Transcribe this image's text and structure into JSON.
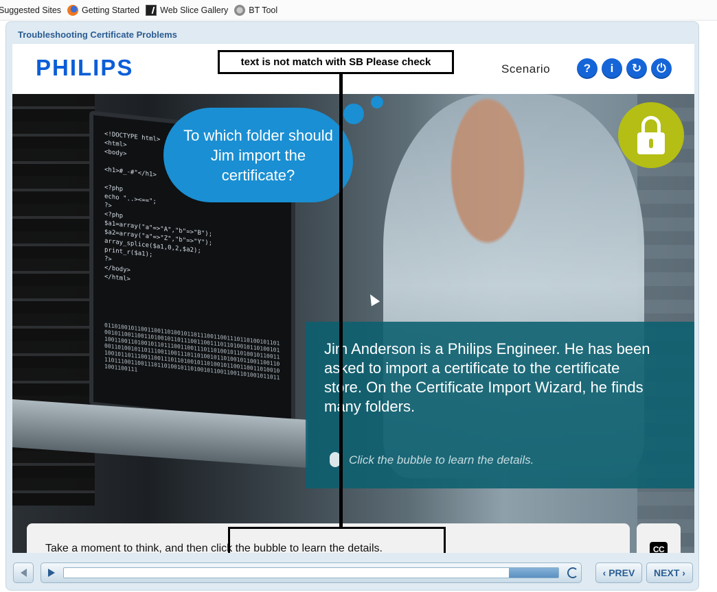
{
  "browser": {
    "favorites": [
      {
        "label": "Suggested Sites",
        "icon": "suggested-sites-icon"
      },
      {
        "label": "Getting Started",
        "icon": "firefox-icon"
      },
      {
        "label": "Web Slice Gallery",
        "icon": "web-slice-icon"
      },
      {
        "label": "BT Tool",
        "icon": "globe-icon"
      }
    ]
  },
  "course": {
    "title": "Troubleshooting Certificate Problems",
    "logo": "PHILIPS",
    "section": "Scenario",
    "header_buttons": [
      {
        "name": "help",
        "glyph": "?"
      },
      {
        "name": "info",
        "glyph": "i"
      },
      {
        "name": "restart",
        "glyph": "↻"
      },
      {
        "name": "exit",
        "glyph": "⏻"
      }
    ],
    "accent": "#1565d8"
  },
  "review": {
    "note": "text is not match with SB Please check"
  },
  "slide": {
    "bubble_text": "To which folder should Jim import the certificate?",
    "info_text": "Jim Anderson is a Philips Engineer. He has been asked to import a certificate to the certificate store. On the Certificate Import Wizard, he finds many folders.",
    "hint": "Click the bubble to learn the details.",
    "caption": "Take a moment to think, and then click the bubble to learn the details.",
    "cc_label": "CC",
    "laptop_code": "<!DOCTYPE html>\n<html>\n<body>\n\n<h1>#_-#\"</h1>\n\n<?php\necho \"..><==\";\n?>\n<?php\n$a1=array(\"a\"=>\"A\",\"b\"=>\"B\");\n$a2=array(\"a\"=>\"Z\",\"b\"=>\"Y\");\narray_splice($a1,0,2,$a2);\nprint_r($a1);\n?>\n</body>\n</html>",
    "binary": "0110100101100110011010010110111001100111011010010110100101100110011010010110111001100111011010010110100101100110011010010110111001100111011010010110100101100110011010010110111001100111011010010110100101100110011010010110111001100111011010010110100101100110011010010110111001100111011010010110100101100110011010010110111001100111"
  },
  "controls": {
    "prev_label": "‹ PREV",
    "next_label": "NEXT ›",
    "progress": 0.9
  }
}
